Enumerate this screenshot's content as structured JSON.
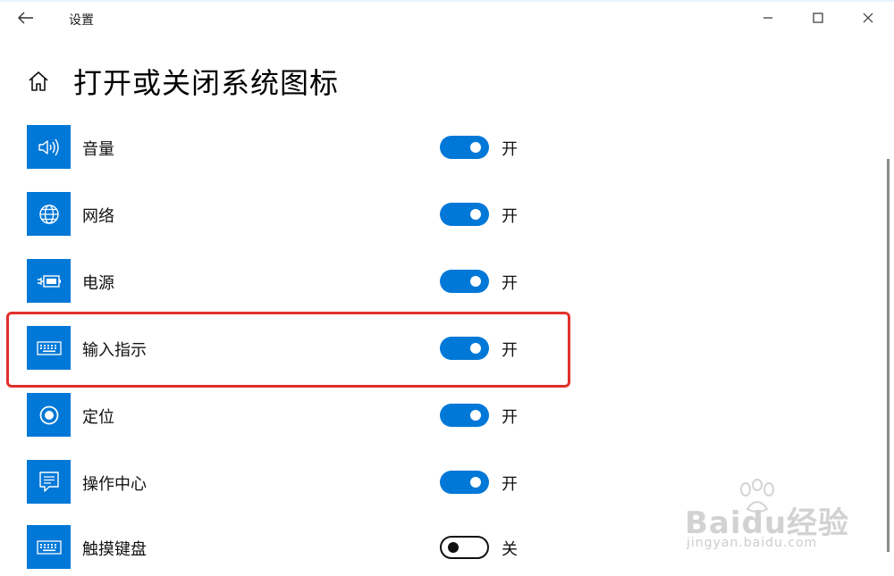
{
  "window": {
    "app_title": "设置"
  },
  "header": {
    "title": "打开或关闭系统图标"
  },
  "items": [
    {
      "label": "音量",
      "state": "开",
      "on": true,
      "icon": "volume-icon"
    },
    {
      "label": "网络",
      "state": "开",
      "on": true,
      "icon": "globe-icon"
    },
    {
      "label": "电源",
      "state": "开",
      "on": true,
      "icon": "battery-plug-icon"
    },
    {
      "label": "输入指示",
      "state": "开",
      "on": true,
      "icon": "keyboard-icon"
    },
    {
      "label": "定位",
      "state": "开",
      "on": true,
      "icon": "location-icon"
    },
    {
      "label": "操作中心",
      "state": "开",
      "on": true,
      "icon": "action-center-icon"
    },
    {
      "label": "触摸键盘",
      "state": "关",
      "on": false,
      "icon": "keyboard-icon"
    }
  ],
  "watermark": {
    "brand": "Baidu经验",
    "url": "jingyan.baidu.com"
  },
  "colors": {
    "accent": "#0078d7",
    "highlight": "#e0302a"
  }
}
